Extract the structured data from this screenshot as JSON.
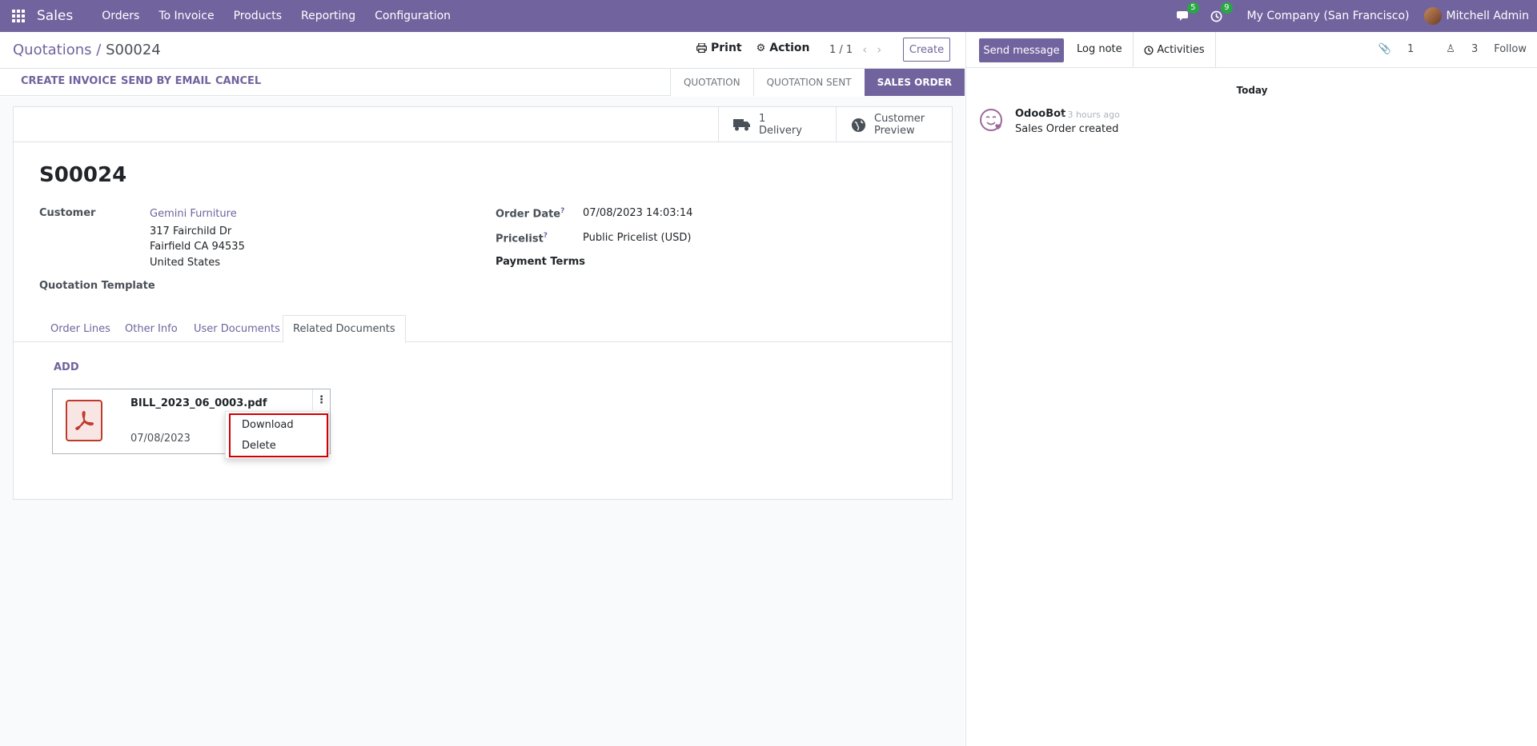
{
  "navbar": {
    "brand": "Sales",
    "menu": [
      "Orders",
      "To Invoice",
      "Products",
      "Reporting",
      "Configuration"
    ],
    "messages_count": "5",
    "activities_count": "9",
    "company": "My Company (San Francisco)",
    "user": "Mitchell Admin"
  },
  "control": {
    "breadcrumb_parent": "Quotations",
    "breadcrumb_sep": " / ",
    "breadcrumb_current": "S00024",
    "print_label": "Print",
    "action_label": "Action",
    "pager": "1 / 1",
    "create_label": "Create",
    "buttons": [
      "CREATE INVOICE",
      "SEND BY EMAIL",
      "CANCEL"
    ],
    "stages": [
      "QUOTATION",
      "QUOTATION SENT",
      "SALES ORDER"
    ],
    "active_stage": "SALES ORDER"
  },
  "smart_buttons": {
    "delivery_count": "1",
    "delivery_label": "Delivery",
    "preview_line1": "Customer",
    "preview_line2": "Preview"
  },
  "form": {
    "title": "S00024",
    "customer_label": "Customer",
    "customer_name": "Gemini Furniture",
    "address_line1": "317 Fairchild Dr",
    "address_line2": "Fairfield CA 94535",
    "address_line3": "United States",
    "template_label": "Quotation Template",
    "order_date_label": "Order Date",
    "order_date": "07/08/2023 14:03:14",
    "pricelist_label": "Pricelist",
    "pricelist": "Public Pricelist (USD)",
    "payment_terms_label": "Payment Terms",
    "help_mark": "?"
  },
  "tabs": [
    "Order Lines",
    "Other Info",
    "User Documents",
    "Related Documents"
  ],
  "documents": {
    "add_label": "ADD",
    "file_name": "BILL_2023_06_0003.pdf",
    "file_date": "07/08/2023",
    "menu": [
      "Download",
      "Delete"
    ]
  },
  "chatter": {
    "send_message": "Send message",
    "log_note": "Log note",
    "activities": "Activities",
    "attachments_count": "1",
    "followers_count": "3",
    "follow": "Follow",
    "day": "Today",
    "author": "OdooBot",
    "time": "- 3 hours ago",
    "body": "Sales Order created"
  },
  "colors": {
    "brand": "#71639e",
    "badge": "#28a745",
    "highlight": "#d00000",
    "pdf": "#c0392b"
  }
}
